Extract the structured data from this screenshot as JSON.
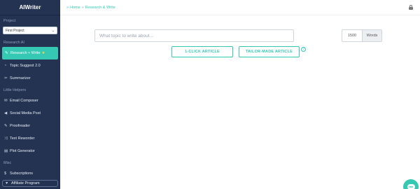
{
  "sidebar": {
    "logo": "AIWriter",
    "project_heading": "Project",
    "project_selected": "First Project",
    "research_heading": "Research AI",
    "research_items": [
      {
        "label": "Research + Write",
        "icon": "pencil-icon",
        "active": true
      },
      {
        "label": "Topic Suggest 2.0",
        "icon": "lightbulb-icon"
      },
      {
        "label": "Summarizer",
        "icon": "wrench-icon"
      }
    ],
    "helpers_heading": "Little Helpers",
    "helpers_items": [
      {
        "label": "Email Composer",
        "icon": "envelope-icon"
      },
      {
        "label": "Social Media Post",
        "icon": "megaphone-icon"
      },
      {
        "label": "Proofreader",
        "icon": "pencil-icon"
      },
      {
        "label": "Text Reworder",
        "icon": "shuffle-icon"
      },
      {
        "label": "Plot Generator",
        "icon": "book-icon"
      }
    ],
    "misc_heading": "Misc",
    "misc_items": [
      {
        "label": "Subscriptions",
        "icon": "dollar-icon"
      },
      {
        "label": "Affiliate Program",
        "icon": "handshake-icon"
      }
    ]
  },
  "header": {
    "crumb_home": "Home",
    "crumb_current": "Research & Write"
  },
  "main": {
    "topic_placeholder": "What topic to write about...",
    "word_count": "1500",
    "word_unit": "Words",
    "button_one_click": "1-CLICK ARTICLE",
    "button_tailor": "TAILOR-MADE ARTICLE",
    "help_symbol": "?"
  },
  "colors": {
    "accent": "#35c9b4",
    "sidebar_bg": "#243352"
  }
}
